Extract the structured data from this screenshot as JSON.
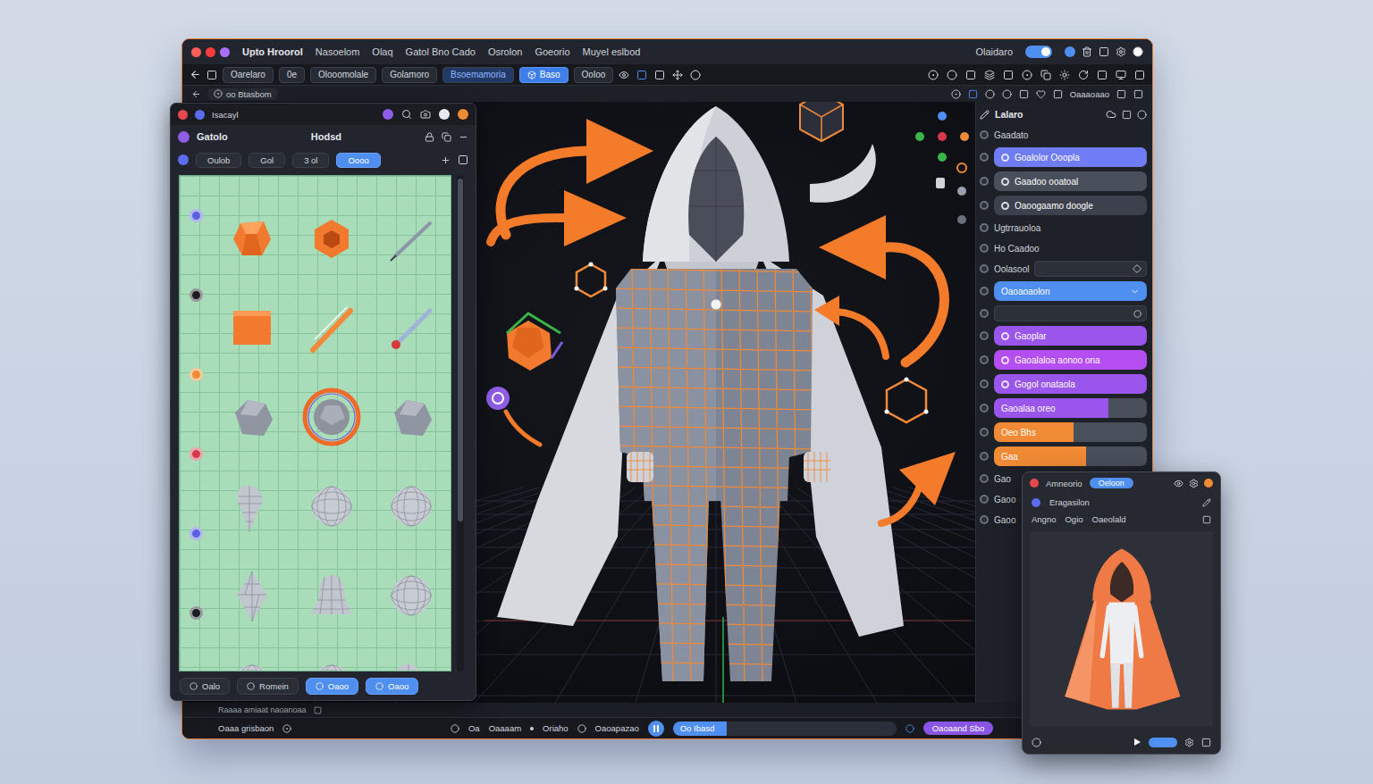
{
  "window": {
    "title": "Upto Hroorol",
    "menu": [
      "Nasoelom",
      "Olaq",
      "Gatol Bno Cado",
      "Osrolon",
      "Goeorio",
      "Muyel eslbod"
    ],
    "account": "Olaidaro",
    "sync_on": true
  },
  "toolbar": [
    {
      "label": "Oarelaro",
      "selected": false,
      "highlighted": false
    },
    {
      "label": "0e",
      "selected": false,
      "highlighted": false
    },
    {
      "label": "Olooomolale",
      "selected": false,
      "highlighted": false
    },
    {
      "label": "Golamoro",
      "selected": false,
      "highlighted": false
    },
    {
      "label": "Bsoemamoria",
      "selected": false,
      "highlighted": true
    },
    {
      "label": "Baso",
      "selected": true,
      "highlighted": false
    },
    {
      "label": "Ooloo",
      "selected": false,
      "highlighted": false
    }
  ],
  "path": {
    "label": "oo Btasbom",
    "right": "Oaaaoaao"
  },
  "library": {
    "title": "Isacayl",
    "name": "Gatolo",
    "mode": "Hodsd",
    "filters": [
      {
        "label": "Oulob",
        "selected": false
      },
      {
        "label": "Gol",
        "selected": false
      },
      {
        "label": "3 ol",
        "selected": false
      },
      {
        "label": "Oooo",
        "selected": true
      }
    ],
    "markers": [
      {
        "color": "#5b5fe0"
      },
      {
        "color": "#1c1d22"
      },
      {
        "color": "#f08a34"
      },
      {
        "color": "#d63a4a"
      },
      {
        "color": "#5b5fe0"
      },
      {
        "color": "#1c1d22"
      }
    ],
    "assets": [
      {
        "kind": "gem",
        "selected": false
      },
      {
        "kind": "nut",
        "selected": false
      },
      {
        "kind": "pencil",
        "selected": false
      },
      {
        "kind": "cube",
        "selected": false
      },
      {
        "kind": "stick",
        "selected": false
      },
      {
        "kind": "pen",
        "selected": false
      },
      {
        "kind": "rock",
        "selected": false
      },
      {
        "kind": "orb",
        "selected": true
      },
      {
        "kind": "rock",
        "selected": false
      },
      {
        "kind": "cone",
        "selected": false
      },
      {
        "kind": "sphere",
        "selected": false
      },
      {
        "kind": "sphere",
        "selected": false
      },
      {
        "kind": "spindle",
        "selected": false
      },
      {
        "kind": "bell",
        "selected": false
      },
      {
        "kind": "sphere",
        "selected": false
      },
      {
        "kind": "sphere",
        "selected": false
      },
      {
        "kind": "sphere",
        "selected": false
      },
      {
        "kind": "cone",
        "selected": false
      }
    ],
    "footer": [
      {
        "label": "Oalo",
        "selected": false
      },
      {
        "label": "Romein",
        "selected": false
      },
      {
        "label": "Oaoo",
        "selected": true
      },
      {
        "label": "Oaoo",
        "selected": true
      }
    ]
  },
  "properties": {
    "title": "Lalaro",
    "rows": [
      {
        "kind": "label",
        "label": "Gaadato"
      },
      {
        "kind": "pill",
        "label": "Goalolor Ooopla",
        "color": "#6f7cf5"
      },
      {
        "kind": "pill",
        "label": "Gaadoo ooatoal",
        "color": "#4a4f5c"
      },
      {
        "kind": "pill",
        "label": "Oaoogaamo doogle",
        "color": "#3c414d"
      },
      {
        "kind": "label",
        "label": "Ugtrrauoloa"
      },
      {
        "kind": "label",
        "label": "Ho Caadoo"
      },
      {
        "kind": "field",
        "label": "Oolasool"
      },
      {
        "kind": "dropdown",
        "label": "Oaoaoaolon",
        "color": "#4f8ff2"
      },
      {
        "kind": "input"
      },
      {
        "kind": "pill",
        "label": "Gaoplar",
        "color": "#9a55ec"
      },
      {
        "kind": "pill",
        "label": "Gaoalaloa aonoo ona",
        "color": "#b44ef0"
      },
      {
        "kind": "pill",
        "label": "Gogol onataola",
        "color": "#9a55ec"
      },
      {
        "kind": "bar",
        "label": "Gaoalaa oreo",
        "color": "#9a55ec",
        "level": 0.75
      },
      {
        "kind": "bar",
        "label": "Oeo Bhs",
        "color": "#f08a34",
        "level": 0.52
      },
      {
        "kind": "bar",
        "label": "Gaa",
        "color": "#f08a34",
        "level": 0.6
      },
      {
        "kind": "label",
        "label": "Gao"
      },
      {
        "kind": "label",
        "label": "Gaoo"
      },
      {
        "kind": "label",
        "label": "Gaoo"
      }
    ]
  },
  "preview": {
    "title": "Amneorio",
    "tab": "Oeloon",
    "name": "Eragasilon",
    "fields": [
      "Angno",
      "Ogio",
      "Oaeolald"
    ]
  },
  "status_bar": {
    "hint": "Raaaa amiaat naoanoaa",
    "items": [
      "Oaaa grisbaon",
      "Oa",
      "Oaaaam",
      "Oriaho",
      "Oaoapazao"
    ],
    "playing": true,
    "timeline": {
      "label": "Oo Ibasd",
      "level": 0.24
    },
    "action": "Oaoaand Sbo"
  }
}
